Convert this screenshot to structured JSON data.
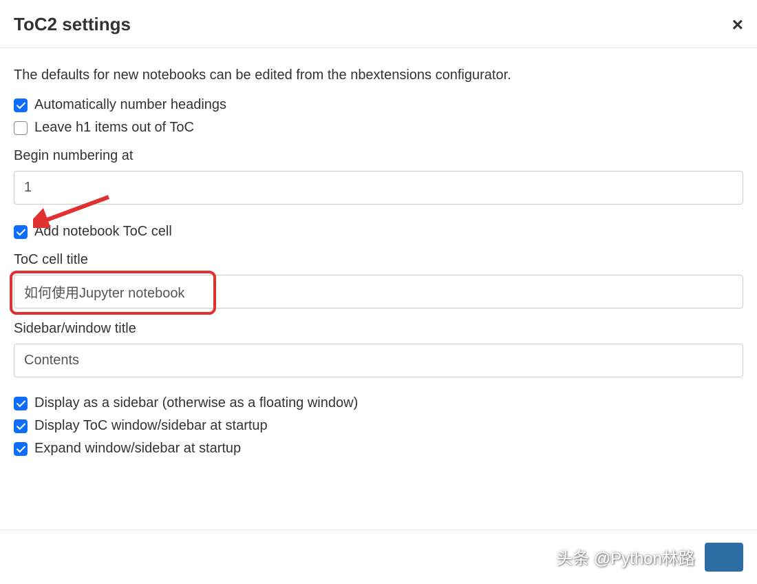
{
  "header": {
    "title": "ToC2 settings"
  },
  "body": {
    "description": "The defaults for new notebooks can be edited from the nbextensions configurator.",
    "auto_number_label": "Automatically number headings",
    "leave_h1_label": "Leave h1 items out of ToC",
    "begin_numbering_label": "Begin numbering at",
    "begin_numbering_value": "1",
    "add_toc_cell_label": "Add notebook ToC cell",
    "toc_cell_title_label": "ToC cell title",
    "toc_cell_title_value": "如何使用Jupyter notebook",
    "sidebar_title_label": "Sidebar/window title",
    "sidebar_title_value": "Contents",
    "display_sidebar_label": "Display as a sidebar (otherwise as a floating window)",
    "display_at_startup_label": "Display ToC window/sidebar at startup",
    "expand_at_startup_label": "Expand window/sidebar at startup"
  },
  "checkboxes": {
    "auto_number": true,
    "leave_h1": false,
    "add_toc_cell": true,
    "display_sidebar": true,
    "display_at_startup": true,
    "expand_at_startup": true
  },
  "watermark": "头条 @Python林路"
}
